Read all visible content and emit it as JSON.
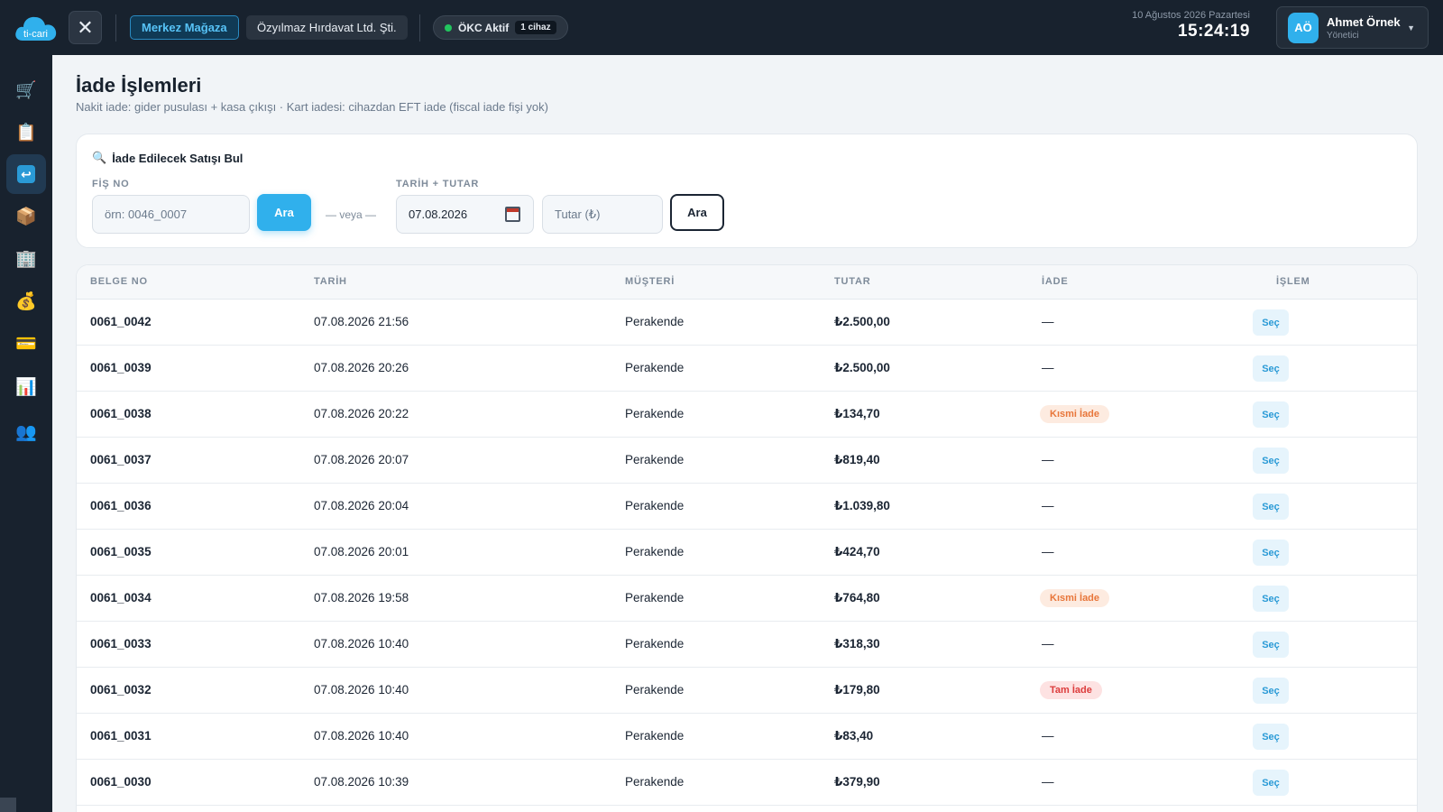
{
  "header": {
    "logo_text": "ti-cari",
    "store": "Merkez Mağaza",
    "company": "Özyılmaz Hırdavat Ltd. Şti.",
    "okc_status": "ÖKC Aktif",
    "okc_devices": "1 cihaz",
    "date": "10 Ağustos 2026 Pazartesi",
    "time": "15:24:19",
    "user_initials": "AÖ",
    "user_name": "Ahmet Örnek",
    "user_role": "Yönetici"
  },
  "sidebar": {
    "items": [
      {
        "icon": "cart-icon",
        "glyph": "🛒"
      },
      {
        "icon": "clipboard-icon",
        "glyph": "📋"
      },
      {
        "icon": "return-icon",
        "glyph": "↩"
      },
      {
        "icon": "box-icon",
        "glyph": "📦"
      },
      {
        "icon": "building-icon",
        "glyph": "🏢"
      },
      {
        "icon": "money-bag-icon",
        "glyph": "💰"
      },
      {
        "icon": "credit-card-icon",
        "glyph": "💳"
      },
      {
        "icon": "bar-chart-icon",
        "glyph": "📊"
      },
      {
        "icon": "users-icon",
        "glyph": "👥"
      }
    ],
    "active_index": 2
  },
  "page": {
    "title": "İade İşlemleri",
    "subtitle": "Nakit iade: gider pusulası + kasa çıkışı · Kart iadesi: cihazdan EFT iade (fiscal iade fişi yok)"
  },
  "search": {
    "heading": "İade Edilecek Satışı Bul",
    "receipt_label": "FİŞ NO",
    "receipt_placeholder": "örn: 0046_0007",
    "search_button": "Ara",
    "or_text": "— veya —",
    "date_amount_label": "TARİH + TUTAR",
    "date_value": "07.08.2026",
    "amount_placeholder": "Tutar (₺)",
    "search_button_2": "Ara"
  },
  "table": {
    "headers": [
      "BELGE NO",
      "TARİH",
      "MÜŞTERİ",
      "TUTAR",
      "İADE",
      "İŞLEM"
    ],
    "action_label": "Seç",
    "rows": [
      {
        "doc": "0061_0042",
        "date": "07.08.2026 21:56",
        "customer": "Perakende",
        "amount": "₺2.500,00",
        "refund": "—",
        "refund_type": "none"
      },
      {
        "doc": "0061_0039",
        "date": "07.08.2026 20:26",
        "customer": "Perakende",
        "amount": "₺2.500,00",
        "refund": "—",
        "refund_type": "none"
      },
      {
        "doc": "0061_0038",
        "date": "07.08.2026 20:22",
        "customer": "Perakende",
        "amount": "₺134,70",
        "refund": "Kısmi İade",
        "refund_type": "partial"
      },
      {
        "doc": "0061_0037",
        "date": "07.08.2026 20:07",
        "customer": "Perakende",
        "amount": "₺819,40",
        "refund": "—",
        "refund_type": "none"
      },
      {
        "doc": "0061_0036",
        "date": "07.08.2026 20:04",
        "customer": "Perakende",
        "amount": "₺1.039,80",
        "refund": "—",
        "refund_type": "none"
      },
      {
        "doc": "0061_0035",
        "date": "07.08.2026 20:01",
        "customer": "Perakende",
        "amount": "₺424,70",
        "refund": "—",
        "refund_type": "none"
      },
      {
        "doc": "0061_0034",
        "date": "07.08.2026 19:58",
        "customer": "Perakende",
        "amount": "₺764,80",
        "refund": "Kısmi İade",
        "refund_type": "partial"
      },
      {
        "doc": "0061_0033",
        "date": "07.08.2026 10:40",
        "customer": "Perakende",
        "amount": "₺318,30",
        "refund": "—",
        "refund_type": "none"
      },
      {
        "doc": "0061_0032",
        "date": "07.08.2026 10:40",
        "customer": "Perakende",
        "amount": "₺179,80",
        "refund": "Tam İade",
        "refund_type": "full"
      },
      {
        "doc": "0061_0031",
        "date": "07.08.2026 10:40",
        "customer": "Perakende",
        "amount": "₺83,40",
        "refund": "—",
        "refund_type": "none"
      },
      {
        "doc": "0061_0030",
        "date": "07.08.2026 10:39",
        "customer": "Perakende",
        "amount": "₺379,90",
        "refund": "—",
        "refund_type": "none"
      }
    ]
  },
  "colors": {
    "accent": "#30b0ec",
    "sidebar_bg": "#18222e",
    "partial_badge": "#e8763a",
    "full_badge": "#dc3c3c"
  }
}
